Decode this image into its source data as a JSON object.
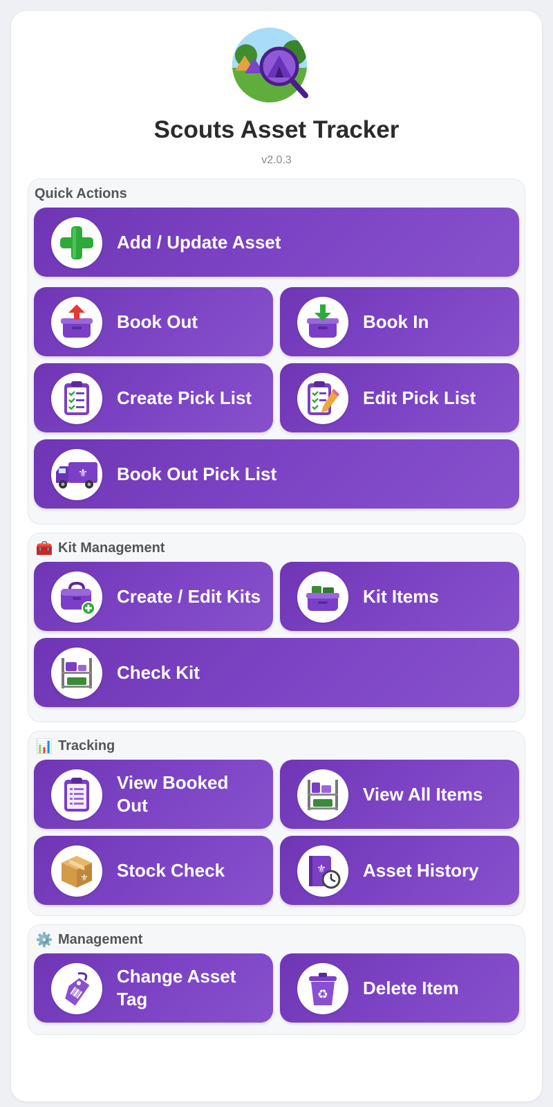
{
  "app": {
    "title": "Scouts Asset Tracker",
    "version": "v2.0.3"
  },
  "colors": {
    "button_purple": "#7c44c4",
    "background": "#eef0f3",
    "section_bg": "#f6f7f9"
  },
  "sections": {
    "quick_actions": {
      "title": "Quick Actions",
      "buttons": {
        "add_update_asset": "Add / Update Asset",
        "book_out": "Book Out",
        "book_in": "Book In",
        "create_pick_list": "Create Pick List",
        "edit_pick_list": "Edit Pick List",
        "book_out_pick_list": "Book Out Pick List"
      }
    },
    "kit_management": {
      "emoji": "🧰",
      "title": "Kit Management",
      "buttons": {
        "create_edit_kits": "Create / Edit Kits",
        "kit_items": "Kit Items",
        "check_kit": "Check Kit"
      }
    },
    "tracking": {
      "emoji": "📊",
      "title": "Tracking",
      "buttons": {
        "view_booked_out": "View Booked Out",
        "view_all_items": "View All Items",
        "stock_check": "Stock Check",
        "asset_history": "Asset History"
      }
    },
    "management": {
      "emoji": "⚙️",
      "title": "Management",
      "buttons": {
        "change_asset_tag": "Change Asset Tag",
        "delete_item": "Delete Item"
      }
    }
  },
  "icons": {
    "logo": "tent-magnifier-logo",
    "add_update_asset": "plus-icon",
    "book_out": "box-arrow-up-icon",
    "book_in": "box-arrow-down-icon",
    "create_pick_list": "clipboard-checklist-icon",
    "edit_pick_list": "clipboard-pencil-icon",
    "book_out_pick_list": "delivery-truck-icon",
    "create_edit_kits": "toolbox-plus-icon",
    "kit_items": "kit-box-icon",
    "check_kit": "shelf-icon",
    "view_booked_out": "clipboard-list-icon",
    "view_all_items": "shelf-items-icon",
    "stock_check": "cardboard-box-icon",
    "asset_history": "book-clock-icon",
    "change_asset_tag": "tag-icon",
    "delete_item": "recycle-bin-icon"
  }
}
